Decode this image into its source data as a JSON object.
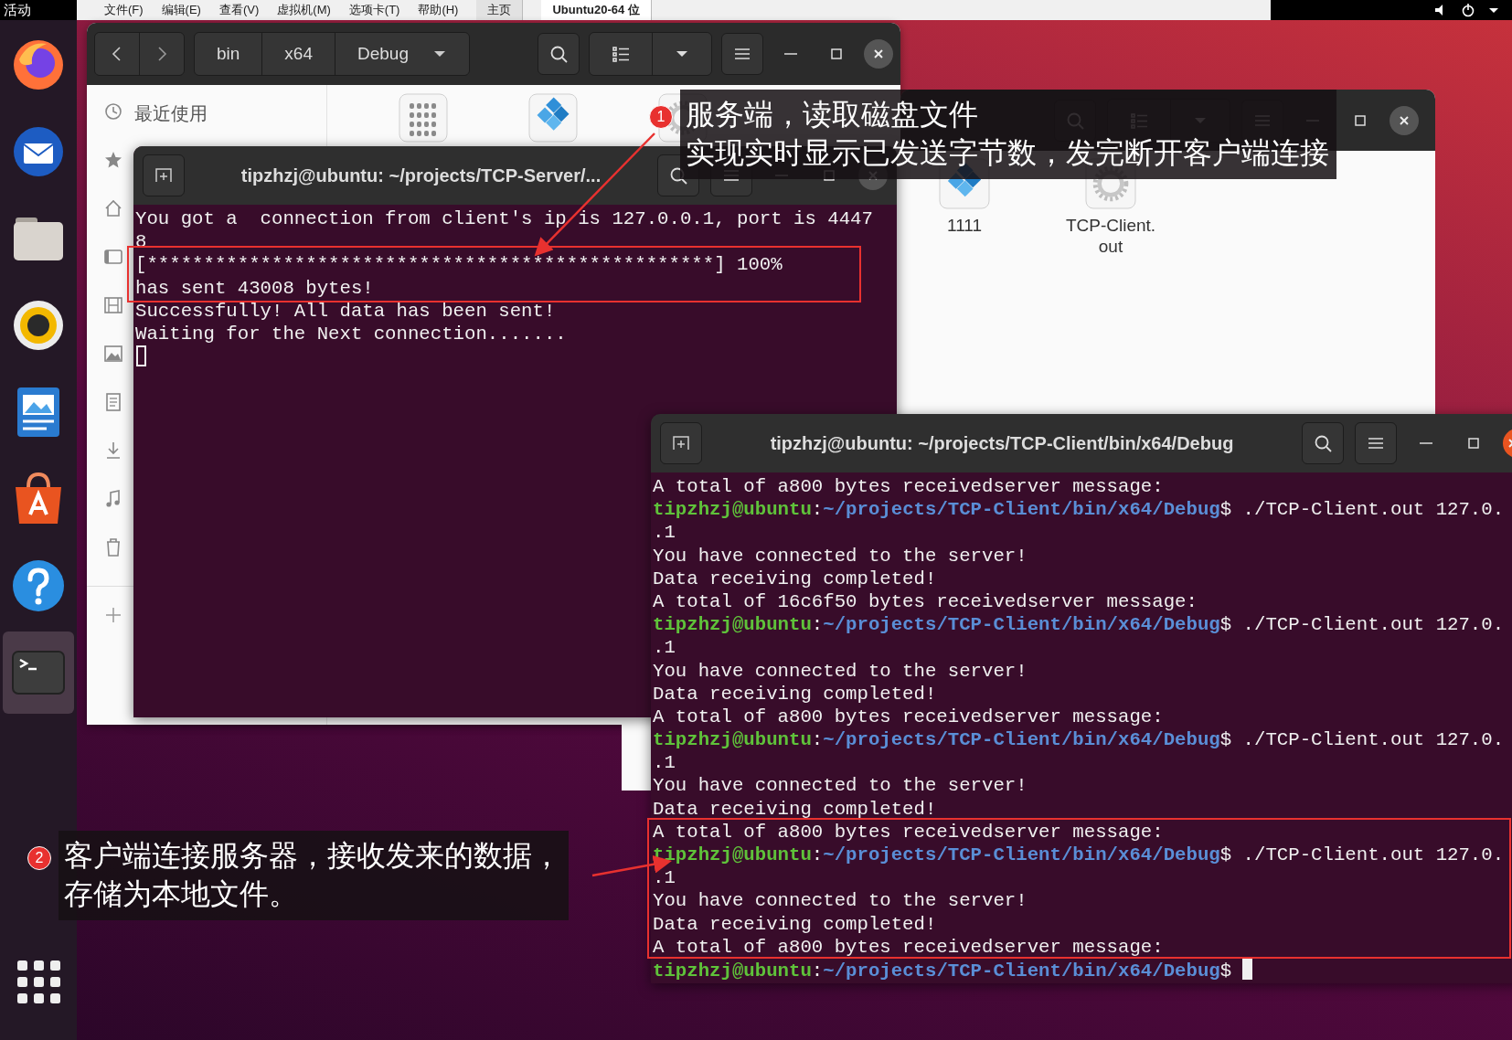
{
  "top_bar": {
    "activities": "活动",
    "menu": [
      "文件(F)",
      "编辑(E)",
      "查看(V)",
      "虚拟机(M)",
      "选项卡(T)",
      "帮助(H)"
    ],
    "tabs": [
      {
        "label": "主页",
        "selected": false
      },
      {
        "label": "Ubuntu20-64 位",
        "selected": true
      }
    ]
  },
  "dock": {
    "items": [
      {
        "kind": "browser",
        "selected": false
      },
      {
        "kind": "mail",
        "selected": false
      },
      {
        "kind": "folder",
        "selected": false
      },
      {
        "kind": "speaker",
        "selected": false
      },
      {
        "kind": "document",
        "selected": false
      },
      {
        "kind": "store",
        "selected": false
      },
      {
        "kind": "help",
        "selected": false
      },
      {
        "kind": "terminal",
        "selected": true
      }
    ]
  },
  "files_window": {
    "path": [
      "bin",
      "x64",
      "Debug"
    ],
    "sidebar": [
      {
        "kind": "recent",
        "label": "最近使用"
      },
      {
        "kind": "star"
      },
      {
        "kind": "home"
      },
      {
        "kind": "desktop"
      },
      {
        "kind": "video"
      },
      {
        "kind": "picture"
      },
      {
        "kind": "doc"
      },
      {
        "kind": "download"
      },
      {
        "kind": "music"
      },
      {
        "kind": "trash"
      },
      {
        "kind": "add"
      }
    ],
    "files": [
      {
        "kind": "binary"
      },
      {
        "kind": "diamond"
      },
      {
        "kind": "gear"
      }
    ]
  },
  "files_window_2": {
    "files": [
      {
        "kind": "diamond",
        "label": "1111"
      },
      {
        "kind": "gear",
        "label": "TCP-Client.\nout"
      }
    ]
  },
  "server_terminal": {
    "title": "tipzhzj@ubuntu: ~/projects/TCP-Server/...",
    "focused": false,
    "lines": [
      {
        "kind": "output",
        "text": "You got a  connection from client's ip is 127.0.0.1, port is 4447"
      },
      {
        "kind": "output",
        "text": "8"
      },
      {
        "kind": "output",
        "text": "[**************************************************] 100%"
      },
      {
        "kind": "output",
        "text": "has sent 43008 bytes!"
      },
      {
        "kind": "output",
        "text": "Successfully! All data has been sent!"
      },
      {
        "kind": "output",
        "text": "Waiting for the Next connection......."
      },
      {
        "kind": "blank"
      }
    ]
  },
  "client_terminal": {
    "title": "tipzhzj@ubuntu: ~/projects/TCP-Client/bin/x64/Debug",
    "focused": true,
    "lines": [
      {
        "kind": "output",
        "text": "A total of a800 bytes receivedserver message:"
      },
      {
        "kind": "prompt",
        "host": "tipzhzj@ubuntu",
        "sep": ":",
        "path": "~/projects/TCP-Client/bin/x64/Debug",
        "command": "$ ./TCP-Client.out 127.0."
      },
      {
        "kind": "output",
        "text": ".1"
      },
      {
        "kind": "output",
        "text": "You have connected to the server!"
      },
      {
        "kind": "output",
        "text": "Data receiving completed!"
      },
      {
        "kind": "output",
        "text": "A total of 16c6f50 bytes receivedserver message:"
      },
      {
        "kind": "prompt",
        "host": "tipzhzj@ubuntu",
        "sep": ":",
        "path": "~/projects/TCP-Client/bin/x64/Debug",
        "command": "$ ./TCP-Client.out 127.0."
      },
      {
        "kind": "output",
        "text": ".1"
      },
      {
        "kind": "output",
        "text": "You have connected to the server!"
      },
      {
        "kind": "output",
        "text": "Data receiving completed!"
      },
      {
        "kind": "output",
        "text": "A total of a800 bytes receivedserver message:"
      },
      {
        "kind": "prompt",
        "host": "tipzhzj@ubuntu",
        "sep": ":",
        "path": "~/projects/TCP-Client/bin/x64/Debug",
        "command": "$ ./TCP-Client.out 127.0."
      },
      {
        "kind": "output",
        "text": ".1"
      },
      {
        "kind": "output",
        "text": "You have connected to the server!"
      },
      {
        "kind": "output",
        "text": "Data receiving completed!"
      },
      {
        "kind": "output",
        "text": "A total of a800 bytes receivedserver message:"
      },
      {
        "kind": "prompt",
        "host": "tipzhzj@ubuntu",
        "sep": ":",
        "path": "~/projects/TCP-Client/bin/x64/Debug",
        "command": "$ ./TCP-Client.out 127.0."
      },
      {
        "kind": "output",
        "text": ".1"
      },
      {
        "kind": "output",
        "text": "You have connected to the server!"
      },
      {
        "kind": "output",
        "text": "Data receiving completed!"
      },
      {
        "kind": "output",
        "text": "A total of a800 bytes receivedserver message:"
      },
      {
        "kind": "prompt",
        "host": "tipzhzj@ubuntu",
        "sep": ":",
        "path": "~/projects/TCP-Client/bin/x64/Debug",
        "command": "$"
      }
    ]
  },
  "annotations": [
    {
      "number": "1",
      "lines": [
        "服务端，读取磁盘文件",
        "实现实时显示已发送字节数，发完断开客户端连接"
      ]
    },
    {
      "number": "2",
      "lines": [
        "客户端连接服务器，接收发来的数据，",
        "存储为本地文件。"
      ]
    }
  ]
}
